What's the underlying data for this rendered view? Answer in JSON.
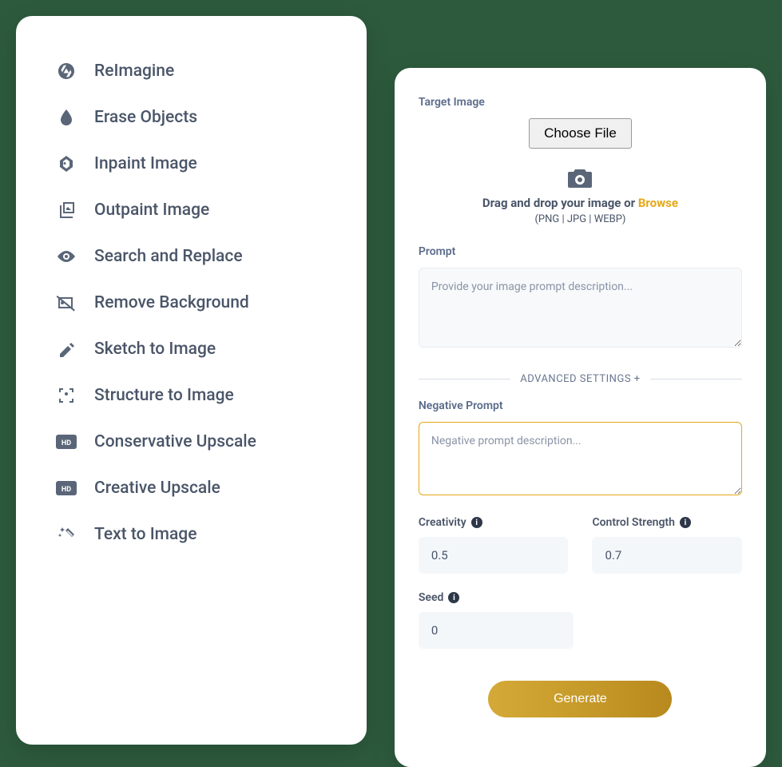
{
  "sidebar": {
    "items": [
      {
        "icon": "aperture-icon",
        "label": "ReImagine"
      },
      {
        "icon": "drop-icon",
        "label": "Erase Objects"
      },
      {
        "icon": "image-icon",
        "label": "Inpaint Image"
      },
      {
        "icon": "gallery-icon",
        "label": "Outpaint Image"
      },
      {
        "icon": "eye-icon",
        "label": "Search and Replace"
      },
      {
        "icon": "remove-bg-icon",
        "label": "Remove Background"
      },
      {
        "icon": "pencil-icon",
        "label": "Sketch to Image"
      },
      {
        "icon": "focus-icon",
        "label": "Structure to Image"
      },
      {
        "icon": "hd-icon",
        "label": "Conservative Upscale"
      },
      {
        "icon": "hd-icon",
        "label": "Creative Upscale"
      },
      {
        "icon": "wand-icon",
        "label": "Text to Image"
      }
    ]
  },
  "form": {
    "target_image_label": "Target Image",
    "choose_file_label": "Choose File",
    "drag_text": "Drag and drop your image or ",
    "browse_label": "Browse",
    "format_text": "(PNG | JPG | WEBP)",
    "prompt_label": "Prompt",
    "prompt_placeholder": "Provide your image prompt description...",
    "advanced_label": "ADVANCED SETTINGS +",
    "neg_prompt_label": "Negative Prompt",
    "neg_prompt_placeholder": "Negative prompt description...",
    "creativity_label": "Creativity",
    "creativity_value": "0.5",
    "control_strength_label": "Control Strength",
    "control_strength_value": "0.7",
    "seed_label": "Seed",
    "seed_value": "0",
    "generate_label": "Generate"
  }
}
